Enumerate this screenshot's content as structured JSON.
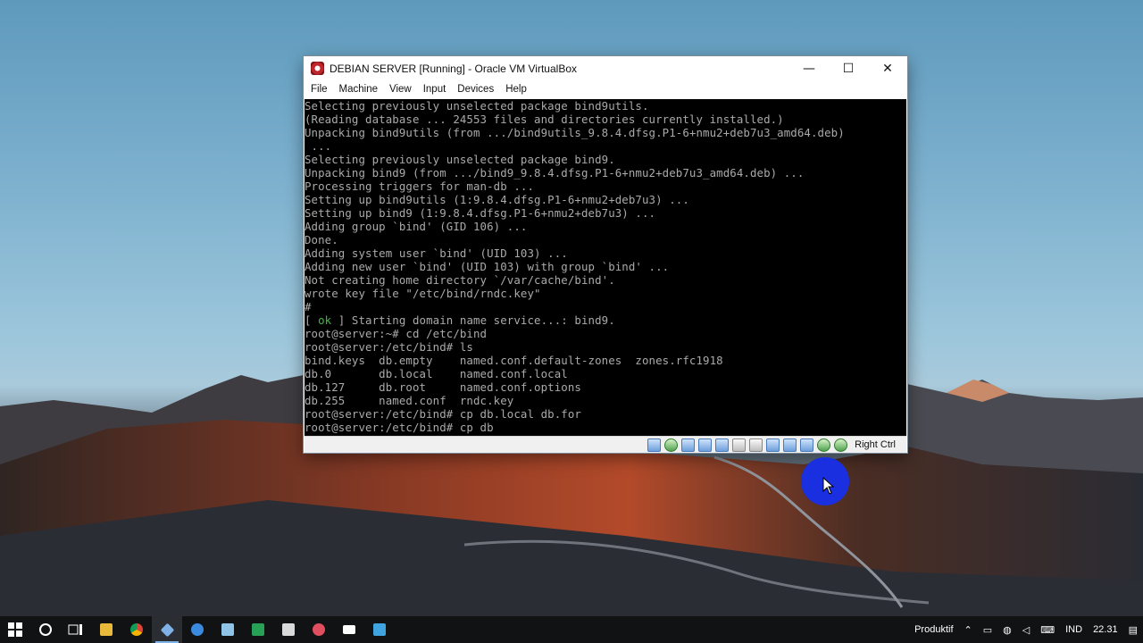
{
  "window": {
    "title": "DEBIAN SERVER [Running] - Oracle VM VirtualBox",
    "minimize_glyph": "—",
    "maximize_glyph": "☐",
    "close_glyph": "✕"
  },
  "menu": [
    "File",
    "Machine",
    "View",
    "Input",
    "Devices",
    "Help"
  ],
  "console": {
    "lines": [
      "Selecting previously unselected package bind9utils.",
      "(Reading database ... 24553 files and directories currently installed.)",
      "Unpacking bind9utils (from .../bind9utils_9.8.4.dfsg.P1-6+nmu2+deb7u3_amd64.deb)",
      " ...",
      "Selecting previously unselected package bind9.",
      "Unpacking bind9 (from .../bind9_9.8.4.dfsg.P1-6+nmu2+deb7u3_amd64.deb) ...",
      "Processing triggers for man-db ...",
      "Setting up bind9utils (1:9.8.4.dfsg.P1-6+nmu2+deb7u3) ...",
      "Setting up bind9 (1:9.8.4.dfsg.P1-6+nmu2+deb7u3) ...",
      "Adding group `bind' (GID 106) ...",
      "Done.",
      "Adding system user `bind' (UID 103) ...",
      "Adding new user `bind' (UID 103) with group `bind' ...",
      "Not creating home directory `/var/cache/bind'.",
      "wrote key file \"/etc/bind/rndc.key\"",
      "#"
    ],
    "ok_line": {
      "open": "[ ",
      "ok": "ok",
      "rest": " ] Starting domain name service...: bind9."
    },
    "lines_after": [
      "root@server:~# cd /etc/bind",
      "root@server:/etc/bind# ls",
      "bind.keys  db.empty    named.conf.default-zones  zones.rfc1918",
      "db.0       db.local    named.conf.local",
      "db.127     db.root     named.conf.options",
      "db.255     named.conf  rndc.key",
      "root@server:/etc/bind# cp db.local db.for",
      "root@server:/etc/bind# cp db"
    ]
  },
  "statusbar": {
    "host_key": "Right Ctrl",
    "icons": [
      "hard-disk-icon",
      "optical-drive-icon",
      "audio-icon",
      "network-icon",
      "usb-icon",
      "shared-folder-icon",
      "display-icon",
      "video-capture-icon",
      "recording-icon",
      "cpu-icon",
      "mouse-integration-icon",
      "keyboard-icon"
    ]
  },
  "taskbar": {
    "apps": [
      "start-icon",
      "cortana-icon",
      "task-view-icon",
      "file-explorer-icon",
      "chrome-icon",
      "virtualbox-icon",
      "app-icon-blue",
      "app-icon-network",
      "app-icon-green",
      "app-icon-media",
      "app-icon-paint",
      "mail-icon",
      "photos-icon"
    ],
    "toolbar_label": "Produktif",
    "language": "IND",
    "time": "22.31"
  }
}
